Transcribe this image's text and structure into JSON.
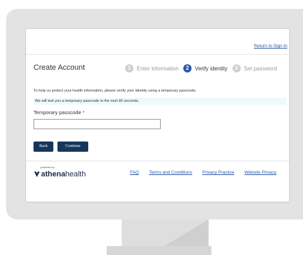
{
  "header": {
    "return_link": "Return to Sign In"
  },
  "page": {
    "title": "Create Account"
  },
  "steps": [
    {
      "number": "1",
      "label": "Enter information",
      "state": "inactive"
    },
    {
      "number": "2",
      "label": "Verify identity",
      "state": "active"
    },
    {
      "number": "3",
      "label": "Set password",
      "state": "inactive"
    }
  ],
  "intro_text": "To help us protect your health information, please verify your identity using a temporary passcode.",
  "notice_text": "We will text you a temporary passcode in the next 90 seconds.",
  "passcode": {
    "label": "Temporary passcode",
    "required_marker": "*",
    "value": "",
    "placeholder": ""
  },
  "buttons": {
    "back": "Back",
    "continue": "Continue"
  },
  "footer": {
    "powered_by": "powered by",
    "logo_bold": "athena",
    "logo_rest": "health",
    "links": [
      "FAQ",
      "Terms and Conditions",
      "Privacy Practice",
      "Website Privacy"
    ]
  },
  "colors": {
    "accent": "#2a57a6",
    "button": "#16365c",
    "notice_bg": "#eef9fb",
    "required": "#c62828"
  }
}
